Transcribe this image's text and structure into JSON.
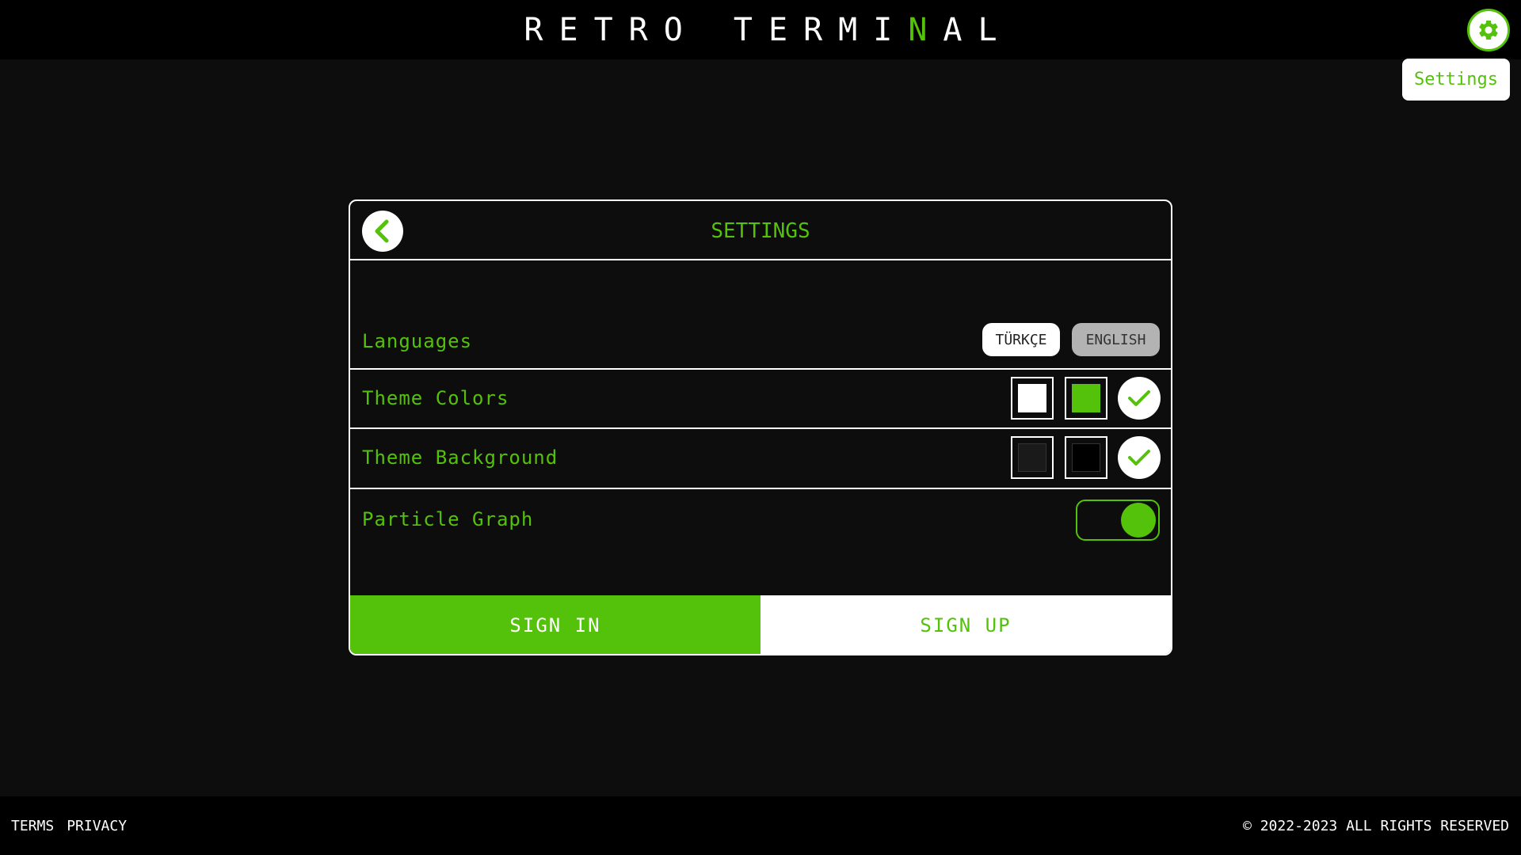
{
  "brand": {
    "prefix": "RETRO TERMI",
    "accent": "N",
    "suffix": "AL"
  },
  "header": {
    "settings_icon": "gear-icon",
    "tooltip": "Settings"
  },
  "settings": {
    "back_icon": "chevron-left-icon",
    "title": "SETTINGS",
    "languages": {
      "label": "Languages",
      "options": [
        "TÜRKÇE",
        "ENGLISH"
      ],
      "selected": "ENGLISH"
    },
    "theme_colors": {
      "label": "Theme Colors",
      "swatches": [
        "#ffffff",
        "#54c10a"
      ],
      "confirm_icon": "check-icon"
    },
    "theme_background": {
      "label": "Theme Background",
      "swatches": [
        "#1a1a1a",
        "#000000"
      ],
      "confirm_icon": "check-icon"
    },
    "particle_graph": {
      "label": "Particle Graph",
      "enabled": true
    }
  },
  "auth": {
    "sign_in": "SIGN IN",
    "sign_up": "SIGN UP"
  },
  "footer": {
    "terms": "TERMS",
    "privacy": "PRIVACY",
    "copyright": "© 2022-2023 ALL RIGHTS RESERVED"
  },
  "colors": {
    "accent": "#54c10a",
    "background": "#0d0d0d",
    "bar": "#000000"
  }
}
